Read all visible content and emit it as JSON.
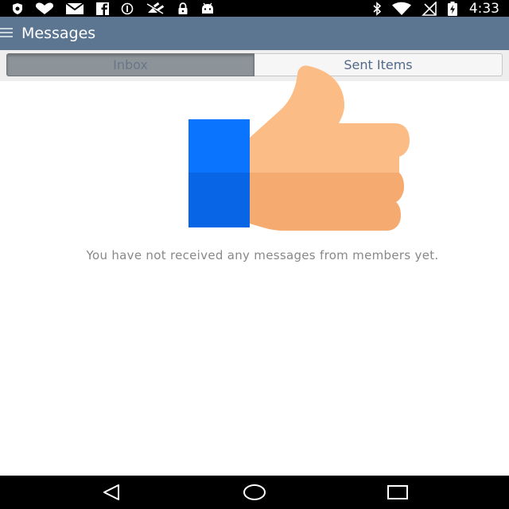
{
  "status_bar": {
    "time": "4:33",
    "left_icons": [
      "shield-icon",
      "heart-icon",
      "mail-icon",
      "facebook-icon",
      "info-icon",
      "satellite-icon",
      "lock-icon",
      "android-icon"
    ],
    "right_icons": [
      "bluetooth-icon",
      "wifi-icon",
      "no-signal-icon",
      "battery-charging-icon"
    ]
  },
  "action_bar": {
    "title": "Messages",
    "color": "#5c7591"
  },
  "tabs": [
    {
      "label": "Inbox",
      "selected": true
    },
    {
      "label": "Sent Items",
      "selected": false
    }
  ],
  "empty_state": {
    "illustration": "thumbs-up-icon",
    "message": "You have not received any messages from members yet."
  },
  "nav_bar": {
    "buttons": [
      "back-icon",
      "home-icon",
      "recents-icon"
    ]
  }
}
